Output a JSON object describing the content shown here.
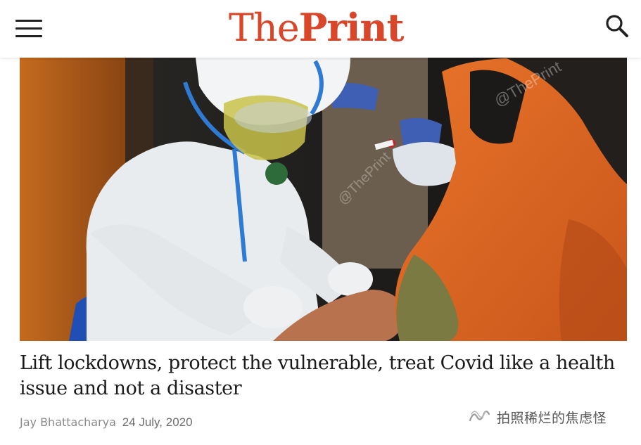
{
  "header": {
    "menu_icon": "hamburger-menu-icon",
    "logo_the": "The",
    "logo_print": "Print",
    "search_icon": "search-icon",
    "brand_color": "#d9472b"
  },
  "article": {
    "image_watermark": "@ThePrint",
    "headline": "Lift lockdowns, protect the vulnerable, treat Covid like a health issue and not a disaster",
    "author": "Jay Bhattacharya",
    "date": "24 July, 2020"
  },
  "watermark": {
    "icon": "wechat-channel-icon",
    "text": "拍照稀烂的焦虑怪"
  }
}
